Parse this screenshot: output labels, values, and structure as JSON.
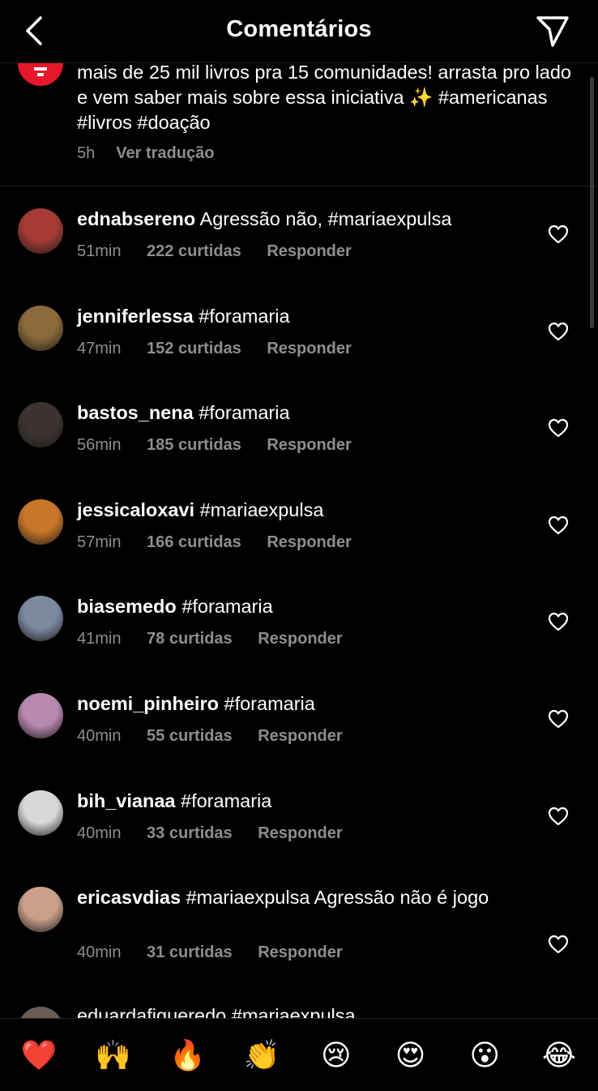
{
  "header": {
    "title": "Comentários"
  },
  "caption": {
    "text": "mais de 25 mil livros pra 15 comunidades! arrasta pro lado e vem saber mais sobre essa iniciativa ✨ #americanas #livros #doação",
    "time": "5h",
    "translate_label": "Ver tradução"
  },
  "comments": [
    {
      "username": "ednabsereno",
      "text": "Agressão não, #mariaexpulsa",
      "time": "51min",
      "likes": "222 curtidas",
      "reply": "Responder",
      "avatar_color": "#a63a34"
    },
    {
      "username": "jenniferlessa",
      "text": "#foramaria",
      "time": "47min",
      "likes": "152 curtidas",
      "reply": "Responder",
      "avatar_color": "#8a6a3a"
    },
    {
      "username": "bastos_nena",
      "text": "#foramaria",
      "time": "56min",
      "likes": "185 curtidas",
      "reply": "Responder",
      "avatar_color": "#3d3431"
    },
    {
      "username": "jessicaloxavi",
      "text": "#mariaexpulsa",
      "time": "57min",
      "likes": "166 curtidas",
      "reply": "Responder",
      "avatar_color": "#c8762a"
    },
    {
      "username": "biasemedo",
      "text": "#foramaria",
      "time": "41min",
      "likes": "78 curtidas",
      "reply": "Responder",
      "avatar_color": "#7c8aa0"
    },
    {
      "username": "noemi_pinheiro",
      "text": "#foramaria",
      "time": "40min",
      "likes": "55 curtidas",
      "reply": "Responder",
      "avatar_color": "#b98ab0"
    },
    {
      "username": "bih_vianaa",
      "text": "#foramaria",
      "time": "40min",
      "likes": "33 curtidas",
      "reply": "Responder",
      "avatar_color": "#d8d8d8"
    },
    {
      "username": "ericasvdias",
      "text": "#mariaexpulsa Agressão não é jogo",
      "time": "40min",
      "likes": "31 curtidas",
      "reply": "Responder",
      "avatar_color": "#caa08a"
    }
  ],
  "partial_comment": {
    "text": "eduardafigueredo #mariaexpulsa"
  },
  "emoji_bar": [
    "❤️",
    "🙌",
    "🔥",
    "👏",
    "😢",
    "😍",
    "😮",
    "😂"
  ]
}
